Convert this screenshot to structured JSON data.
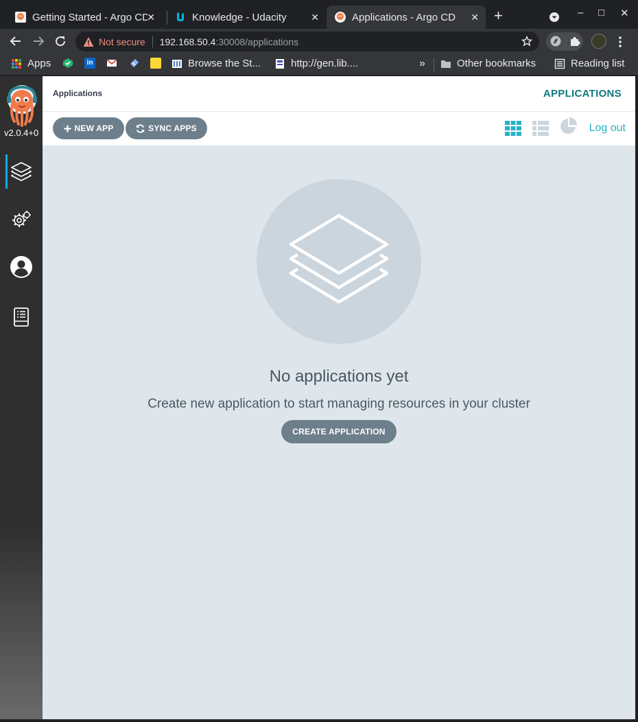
{
  "browser": {
    "tabs": [
      {
        "title": "Getting Started - Argo CD",
        "active": false
      },
      {
        "title": "Knowledge - Udacity",
        "active": false
      },
      {
        "title": "Applications - Argo CD",
        "active": true
      }
    ],
    "new_tab_glyph": "+",
    "close_glyph": "✕",
    "window_controls": {
      "minimize": "–",
      "maximize": "□",
      "close": "✕"
    },
    "address": {
      "security_label": "Not secure",
      "host": "192.168.50.4",
      "path": ":30008/applications"
    },
    "bookmarks": [
      {
        "label": "Apps",
        "color": "#e8eaed"
      },
      {
        "label": "",
        "color": "#29b471"
      },
      {
        "label": "in",
        "color": "#0a66c2"
      },
      {
        "label": "",
        "color": "#d93025"
      },
      {
        "label": "",
        "color": "#8ab4f8"
      },
      {
        "label": "",
        "color": "#fdd835"
      },
      {
        "label": "Browse the St...",
        "color": "#4a78c2"
      },
      {
        "label": "http://gen.lib....",
        "color": "#3f51b5"
      }
    ],
    "overflow_glyph": "»",
    "other_bookmarks": "Other bookmarks",
    "reading_list": "Reading list"
  },
  "argo": {
    "version": "v2.0.4+0",
    "breadcrumb": "Applications",
    "page_title": "APPLICATIONS",
    "actions": {
      "new_app": "NEW APP",
      "sync_apps": "SYNC APPS",
      "logout": "Log out"
    },
    "empty_state": {
      "title": "No applications yet",
      "subtitle": "Create new application to start managing resources in your cluster",
      "cta": "CREATE APPLICATION"
    },
    "colors": {
      "accent": "#27b2c5",
      "button": "#6d7f8b",
      "content_bg": "#dee6eb",
      "sidebar_bg": "#2f2f2f"
    }
  }
}
